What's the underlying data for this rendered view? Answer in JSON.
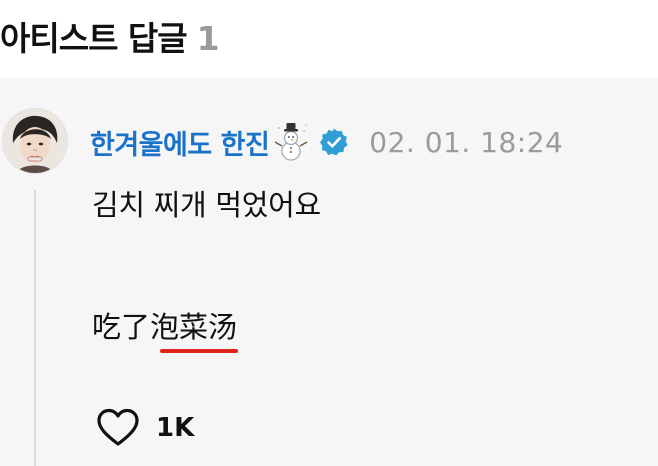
{
  "header": {
    "title": "아티스트 답글",
    "count": "1"
  },
  "comment": {
    "author": "한겨울에도 한진",
    "author_emoji_icon": "snowman-icon",
    "verified_icon": "verified-check-icon",
    "timestamp": "02. 01. 18:24",
    "text_line1": "김치 찌개 먹었어요",
    "text_line2": "吃了泡菜汤",
    "like_icon": "heart-outline-icon",
    "like_count": "1K"
  },
  "colors": {
    "author": "#1a73c8",
    "verified": "#2f9fd6",
    "timestamp": "#9b9b9b",
    "background": "#f6f6f6",
    "underline": "#e0241b"
  }
}
